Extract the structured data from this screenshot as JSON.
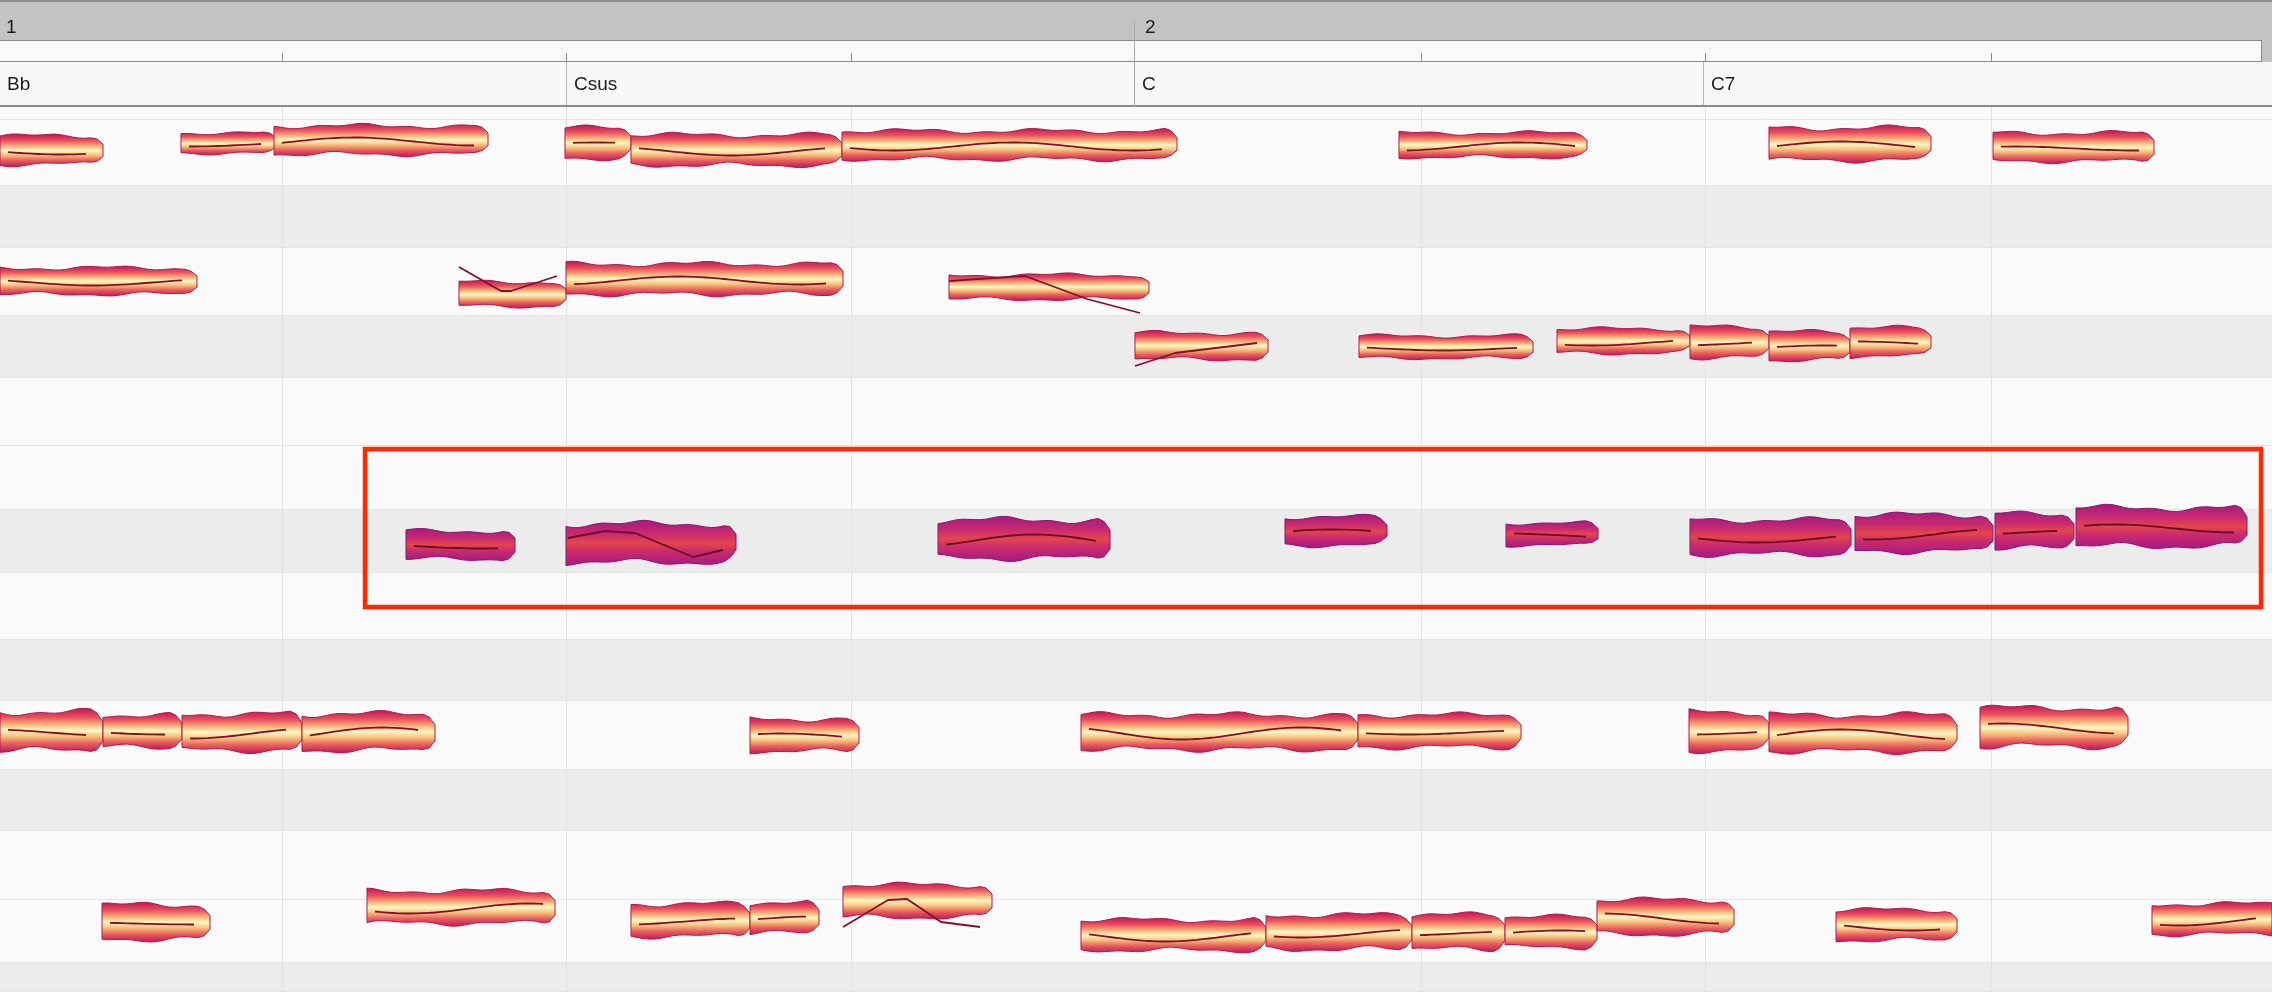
{
  "ruler": {
    "bars": [
      {
        "number": "1"
      },
      {
        "number": "2"
      }
    ]
  },
  "chord_track": {
    "chords": [
      {
        "name": "Bb"
      },
      {
        "name": "Csus"
      },
      {
        "name": "C"
      },
      {
        "name": "C7"
      }
    ]
  },
  "editor": {
    "marquee": {
      "visible": true
    },
    "notes": [
      {
        "selected": false
      },
      {
        "selected": false
      },
      {
        "selected": false
      },
      {
        "selected": false
      },
      {
        "selected": false
      },
      {
        "selected": false
      },
      {
        "selected": false
      },
      {
        "selected": false
      },
      {
        "selected": false
      },
      {
        "selected": false
      },
      {
        "selected": false
      },
      {
        "selected": false
      },
      {
        "selected": false
      },
      {
        "selected": false
      },
      {
        "selected": false
      },
      {
        "selected": false
      },
      {
        "selected": false
      },
      {
        "selected": false
      },
      {
        "selected": false
      },
      {
        "selected": true
      },
      {
        "selected": true
      },
      {
        "selected": true
      },
      {
        "selected": true
      },
      {
        "selected": true
      },
      {
        "selected": true
      },
      {
        "selected": true
      },
      {
        "selected": true
      },
      {
        "selected": true
      },
      {
        "selected": false
      },
      {
        "selected": false
      },
      {
        "selected": false
      },
      {
        "selected": false
      },
      {
        "selected": false
      },
      {
        "selected": false
      },
      {
        "selected": false
      },
      {
        "selected": false
      },
      {
        "selected": false
      },
      {
        "selected": false
      },
      {
        "selected": false
      },
      {
        "selected": false
      },
      {
        "selected": false
      },
      {
        "selected": false
      },
      {
        "selected": false
      },
      {
        "selected": false
      },
      {
        "selected": false
      },
      {
        "selected": false
      },
      {
        "selected": false
      },
      {
        "selected": false
      },
      {
        "selected": false
      },
      {
        "selected": false
      }
    ]
  }
}
